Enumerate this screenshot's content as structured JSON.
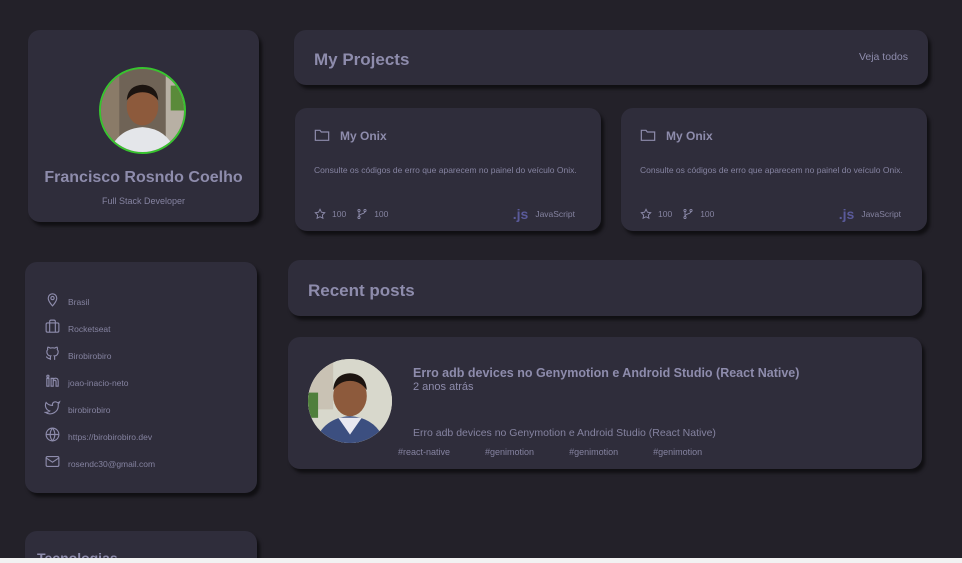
{
  "profile": {
    "name": "Francisco Rosndo Coelho",
    "role": "Full Stack Developer"
  },
  "contacts": [
    {
      "icon": "location-pin-icon",
      "label": "Brasil"
    },
    {
      "icon": "briefcase-icon",
      "label": "Rocketseat"
    },
    {
      "icon": "github-icon",
      "label": "Birobirobiro"
    },
    {
      "icon": "linkedin-icon",
      "label": "joao-inacio-neto"
    },
    {
      "icon": "twitter-icon",
      "label": "birobirobiro"
    },
    {
      "icon": "globe-icon",
      "label": "https://birobirobiro.dev"
    },
    {
      "icon": "mail-icon",
      "label": "rosendc30@gmail.com"
    }
  ],
  "tech": {
    "title": "Tecnologias"
  },
  "projects": {
    "title": "My Projects",
    "see_all": "Veja todos",
    "items": [
      {
        "title": "My Onix",
        "description": "Consulte os códigos de erro que aparecem no painel do veículo Onix.",
        "stars": "100",
        "forks": "100",
        "lang_badge": ".js",
        "language": "JavaScript"
      },
      {
        "title": "My Onix",
        "description": "Consulte os códigos de erro que aparecem no painel do veículo Onix.",
        "stars": "100",
        "forks": "100",
        "lang_badge": ".js",
        "language": "JavaScript"
      }
    ]
  },
  "posts": {
    "title": "Recent posts",
    "items": [
      {
        "title": "Erro adb devices no Genymotion e Android Studio (React Native)",
        "time": "2 anos atrás",
        "excerpt": "Erro adb devices no Genymotion e Android Studio (React Native)",
        "tags": [
          "#react-native",
          "#genimotion",
          "#genimotion",
          "#genimotion"
        ]
      }
    ]
  },
  "colors": {
    "background": "#232129",
    "card": "#2f2d3b",
    "text": "#8e8cac",
    "avatar_ring": "#38c42f",
    "js_badge": "#5a5a9a"
  }
}
